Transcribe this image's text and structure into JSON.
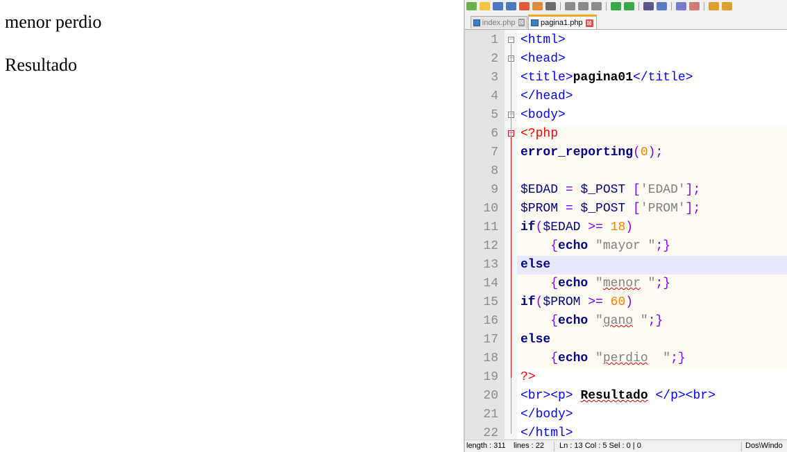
{
  "browser": {
    "output_line1": "menor perdio",
    "output_line2": "Resultado"
  },
  "editor": {
    "tabs": [
      {
        "label": "index.php",
        "active": false
      },
      {
        "label": "pagina1.php",
        "active": true
      }
    ],
    "close_glyph": "⊠",
    "lines": [
      {
        "n": "1",
        "segments": [
          {
            "t": "<html>",
            "c": "tag"
          }
        ]
      },
      {
        "n": "2",
        "segments": [
          {
            "t": "<head>",
            "c": "tag"
          }
        ]
      },
      {
        "n": "3",
        "segments": [
          {
            "t": "<title>",
            "c": "tag"
          },
          {
            "t": "pagina01",
            "c": "bold"
          },
          {
            "t": "</title>",
            "c": "tag"
          }
        ]
      },
      {
        "n": "4",
        "segments": [
          {
            "t": "</head>",
            "c": "tag"
          }
        ]
      },
      {
        "n": "5",
        "segments": [
          {
            "t": "<body>",
            "c": "tag"
          }
        ]
      },
      {
        "n": "6",
        "segments": [
          {
            "t": "<?php",
            "c": "php"
          }
        ]
      },
      {
        "n": "7",
        "segments": [
          {
            "t": "error_reporting",
            "c": "kw"
          },
          {
            "t": "(",
            "c": "op"
          },
          {
            "t": "0",
            "c": "num-lit"
          },
          {
            "t": ");",
            "c": "op"
          }
        ]
      },
      {
        "n": "8",
        "segments": []
      },
      {
        "n": "9",
        "segments": [
          {
            "t": "$EDAD ",
            "c": "var"
          },
          {
            "t": "=",
            "c": "op"
          },
          {
            "t": " $_POST ",
            "c": "var"
          },
          {
            "t": "[",
            "c": "op"
          },
          {
            "t": "'EDAD'",
            "c": "str"
          },
          {
            "t": "];",
            "c": "op"
          }
        ]
      },
      {
        "n": "10",
        "segments": [
          {
            "t": "$PROM ",
            "c": "var"
          },
          {
            "t": "=",
            "c": "op"
          },
          {
            "t": " $_POST ",
            "c": "var"
          },
          {
            "t": "[",
            "c": "op"
          },
          {
            "t": "'PROM'",
            "c": "str"
          },
          {
            "t": "];",
            "c": "op"
          }
        ]
      },
      {
        "n": "11",
        "segments": [
          {
            "t": "if",
            "c": "kw"
          },
          {
            "t": "(",
            "c": "op"
          },
          {
            "t": "$EDAD ",
            "c": "var"
          },
          {
            "t": ">=",
            "c": "op"
          },
          {
            "t": " ",
            "c": ""
          },
          {
            "t": "18",
            "c": "num-lit"
          },
          {
            "t": ")",
            "c": "op"
          }
        ]
      },
      {
        "n": "12",
        "segments": [
          {
            "t": "    ",
            "c": ""
          },
          {
            "t": "{",
            "c": "op"
          },
          {
            "t": "echo",
            "c": "kw"
          },
          {
            "t": " \"mayor \"",
            "c": "str"
          },
          {
            "t": ";}",
            "c": "op"
          }
        ]
      },
      {
        "n": "13",
        "segments": [
          {
            "t": "else",
            "c": "kw"
          }
        ]
      },
      {
        "n": "14",
        "segments": [
          {
            "t": "    ",
            "c": ""
          },
          {
            "t": "{",
            "c": "op"
          },
          {
            "t": "echo",
            "c": "kw"
          },
          {
            "t": " \"",
            "c": "str"
          },
          {
            "t": "menor",
            "c": "str squig"
          },
          {
            "t": " \"",
            "c": "str"
          },
          {
            "t": ";}",
            "c": "op"
          }
        ]
      },
      {
        "n": "15",
        "segments": [
          {
            "t": "if",
            "c": "kw"
          },
          {
            "t": "(",
            "c": "op"
          },
          {
            "t": "$PROM ",
            "c": "var"
          },
          {
            "t": ">=",
            "c": "op"
          },
          {
            "t": " ",
            "c": ""
          },
          {
            "t": "60",
            "c": "num-lit"
          },
          {
            "t": ")",
            "c": "op"
          }
        ]
      },
      {
        "n": "16",
        "segments": [
          {
            "t": "    ",
            "c": ""
          },
          {
            "t": "{",
            "c": "op"
          },
          {
            "t": "echo",
            "c": "kw"
          },
          {
            "t": " \"",
            "c": "str"
          },
          {
            "t": "gano",
            "c": "str squig"
          },
          {
            "t": " \"",
            "c": "str"
          },
          {
            "t": ";}",
            "c": "op"
          }
        ]
      },
      {
        "n": "17",
        "segments": [
          {
            "t": "else",
            "c": "kw"
          }
        ]
      },
      {
        "n": "18",
        "segments": [
          {
            "t": "    ",
            "c": ""
          },
          {
            "t": "{",
            "c": "op"
          },
          {
            "t": "echo",
            "c": "kw"
          },
          {
            "t": " \"",
            "c": "str"
          },
          {
            "t": "perdio",
            "c": "str squig"
          },
          {
            "t": "  \"",
            "c": "str"
          },
          {
            "t": ";}",
            "c": "op"
          }
        ]
      },
      {
        "n": "19",
        "segments": [
          {
            "t": "?>",
            "c": "php"
          }
        ]
      },
      {
        "n": "20",
        "segments": [
          {
            "t": "<br><p>",
            "c": "tag"
          },
          {
            "t": " ",
            "c": ""
          },
          {
            "t": "Resultado",
            "c": "bold squig"
          },
          {
            "t": " ",
            "c": ""
          },
          {
            "t": "</p><br>",
            "c": "tag"
          }
        ]
      },
      {
        "n": "21",
        "segments": [
          {
            "t": "</body>",
            "c": "tag"
          }
        ]
      },
      {
        "n": "22",
        "segments": [
          {
            "t": "</html>",
            "c": "tag"
          }
        ]
      }
    ],
    "status": {
      "length": "length : 311",
      "lines": "lines : 22",
      "position": "Ln : 13    Col : 5    Sel : 0 | 0",
      "eol": "Dos\\Windo"
    }
  }
}
